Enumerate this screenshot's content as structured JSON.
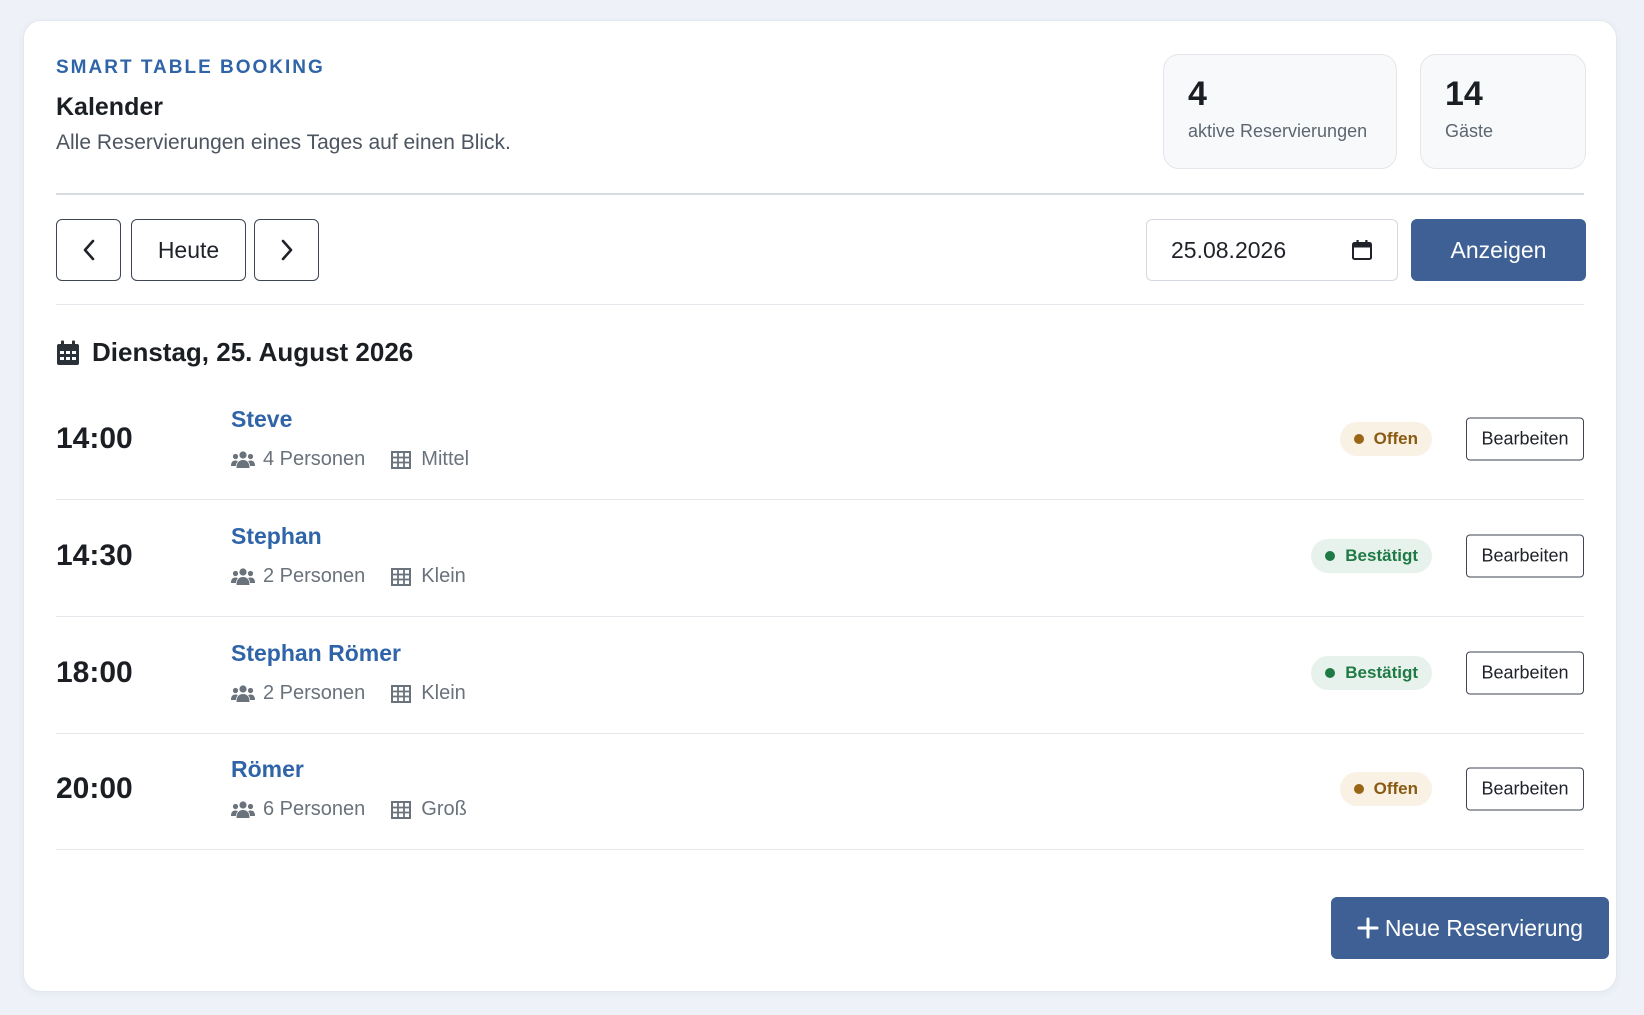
{
  "header": {
    "eyebrow": "SMART TABLE BOOKING",
    "title": "Kalender",
    "subtitle": "Alle Reservierungen eines Tages auf einen Blick."
  },
  "stats": [
    {
      "value": "4",
      "label": "aktive Reservierungen"
    },
    {
      "value": "14",
      "label": "Gäste"
    }
  ],
  "toolbar": {
    "prev_icon": "chevron-left-icon",
    "today_label": "Heute",
    "next_icon": "chevron-right-icon",
    "date_value": "25.08.2026",
    "calendar_icon": "calendar-icon",
    "show_label": "Anzeigen"
  },
  "day": {
    "icon": "calendar-icon",
    "heading": "Dienstag, 25. August 2026"
  },
  "reservations": [
    {
      "time": "14:00",
      "name": "Steve",
      "persons": "4 Personen",
      "table": "Mittel",
      "status": "Offen",
      "status_kind": "offen",
      "edit_label": "Bearbeiten"
    },
    {
      "time": "14:30",
      "name": "Stephan",
      "persons": "2 Personen",
      "table": "Klein",
      "status": "Bestätigt",
      "status_kind": "best",
      "edit_label": "Bearbeiten"
    },
    {
      "time": "18:00",
      "name": "Stephan Römer",
      "persons": "2 Personen",
      "table": "Klein",
      "status": "Bestätigt",
      "status_kind": "best",
      "edit_label": "Bearbeiten"
    },
    {
      "time": "20:00",
      "name": "Römer",
      "persons": "6 Personen",
      "table": "Groß",
      "status": "Offen",
      "status_kind": "offen",
      "edit_label": "Bearbeiten"
    }
  ],
  "new_button": {
    "label": "Neue Reservierung",
    "icon": "plus-icon"
  },
  "colors": {
    "accent": "#2f64a8",
    "primary_button": "#3f6094",
    "status_open": "#8a5a12",
    "status_confirmed": "#1f7a45",
    "background": "#eef2f8"
  }
}
